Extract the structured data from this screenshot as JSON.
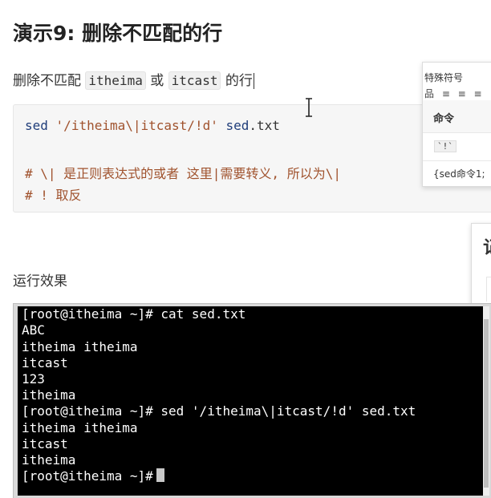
{
  "title": "演示9: 删除不匹配的行",
  "description": {
    "prefix": "删除不匹配",
    "code1": "itheima",
    "middle": "或",
    "code2": "itcast",
    "suffix": "的行"
  },
  "code_block": {
    "cmd": "sed",
    "arg": "'/itheima\\|itcast/!d'",
    "file_name": "sed",
    "file_dot": ".",
    "file_ext": "txt",
    "comment1": "# \\| 是正则表达式的或者 这里|需要转义, 所以为\\|",
    "comment2": "# ! 取反"
  },
  "popup": {
    "title": "特殊符号",
    "tools": "品 ≡ ≡ ≡",
    "header": "命令",
    "cell_code": "`!`",
    "cell2": "{sed命令1;"
  },
  "popup2": {
    "label": "记"
  },
  "result_label": "运行效果",
  "terminal": {
    "lines": [
      "[root@itheima ~]# cat sed.txt",
      "ABC",
      "itheima itheima",
      "itcast",
      "123",
      "itheima",
      "[root@itheima ~]# sed '/itheima\\|itcast/!d' sed.txt",
      "itheima itheima",
      "itcast",
      "itheima"
    ],
    "prompt": "[root@itheima ~]#"
  }
}
